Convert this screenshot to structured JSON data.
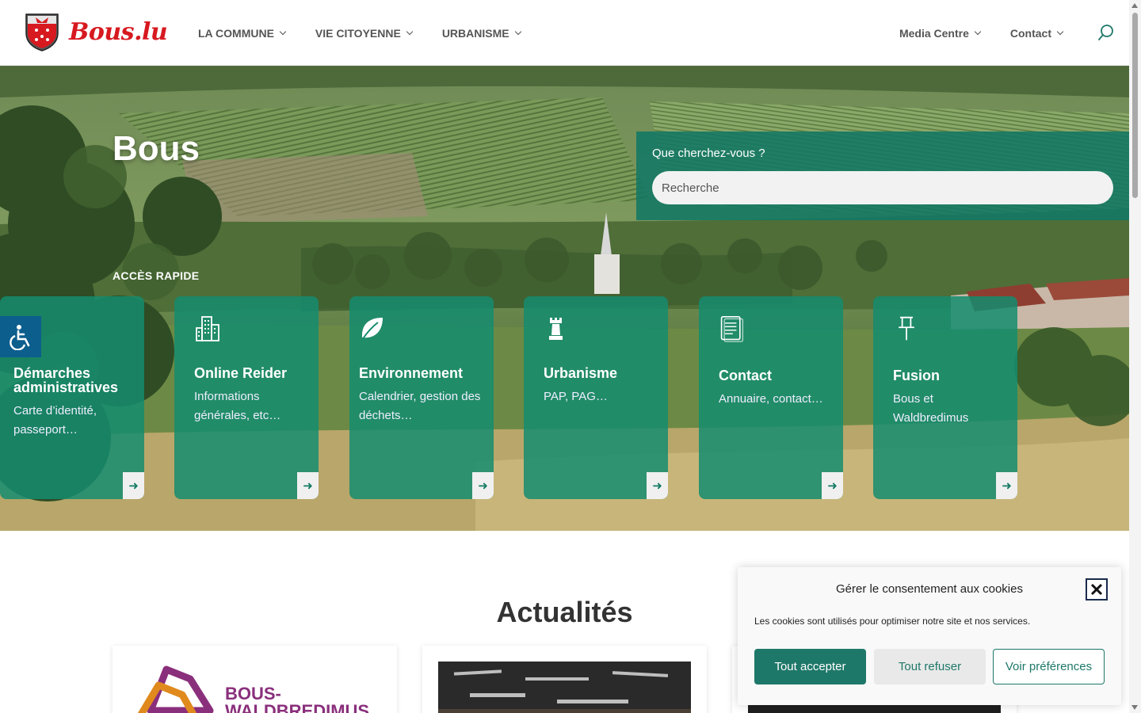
{
  "header": {
    "logo_text": "Bous.lu",
    "nav_left": [
      {
        "label": "LA COMMUNE"
      },
      {
        "label": "VIE CITOYENNE"
      },
      {
        "label": "URBANISME"
      }
    ],
    "nav_right": [
      {
        "label": "Media Centre"
      },
      {
        "label": "Contact"
      }
    ]
  },
  "hero": {
    "title": "Bous",
    "search": {
      "label": "Que cherchez-vous ?",
      "placeholder": "Recherche"
    },
    "quick_access_label": "ACCÈS RAPIDE",
    "cards": [
      {
        "title": "Démarches administratives",
        "desc": "Carte d’identité, passeport…",
        "icon": "document-icon"
      },
      {
        "title": "Online Reider",
        "desc": "Informations générales, etc…",
        "icon": "building-icon"
      },
      {
        "title": "Environnement",
        "desc": " Calendrier, gestion des déchets…",
        "icon": "leaf-icon"
      },
      {
        "title": "Urbanisme",
        "desc": "PAP, PAG…",
        "icon": "tower-icon"
      },
      {
        "title": "Contact",
        "desc": "Annuaire, contact…",
        "icon": "notepad-icon"
      },
      {
        "title": "Fusion",
        "desc": "Bous et Waldbredimus",
        "icon": "pin-icon"
      }
    ],
    "card_arrow": "➜"
  },
  "news": {
    "title": "Actualités",
    "card1_logo_line1": "BOUS-",
    "card1_logo_line2": "WALDBREDIMUS"
  },
  "cookie": {
    "title": "Gérer le consentement aux cookies",
    "text": "Les cookies sont utilisés pour optimiser notre site et nos services.",
    "accept": "Tout accepter",
    "refuse": "Tout refuser",
    "prefs": "Voir préférences"
  },
  "colors": {
    "brand_red": "#d71920",
    "teal": "#1e7869",
    "card_teal": "#148c6e",
    "accessibility_blue": "#0c5e8d"
  }
}
